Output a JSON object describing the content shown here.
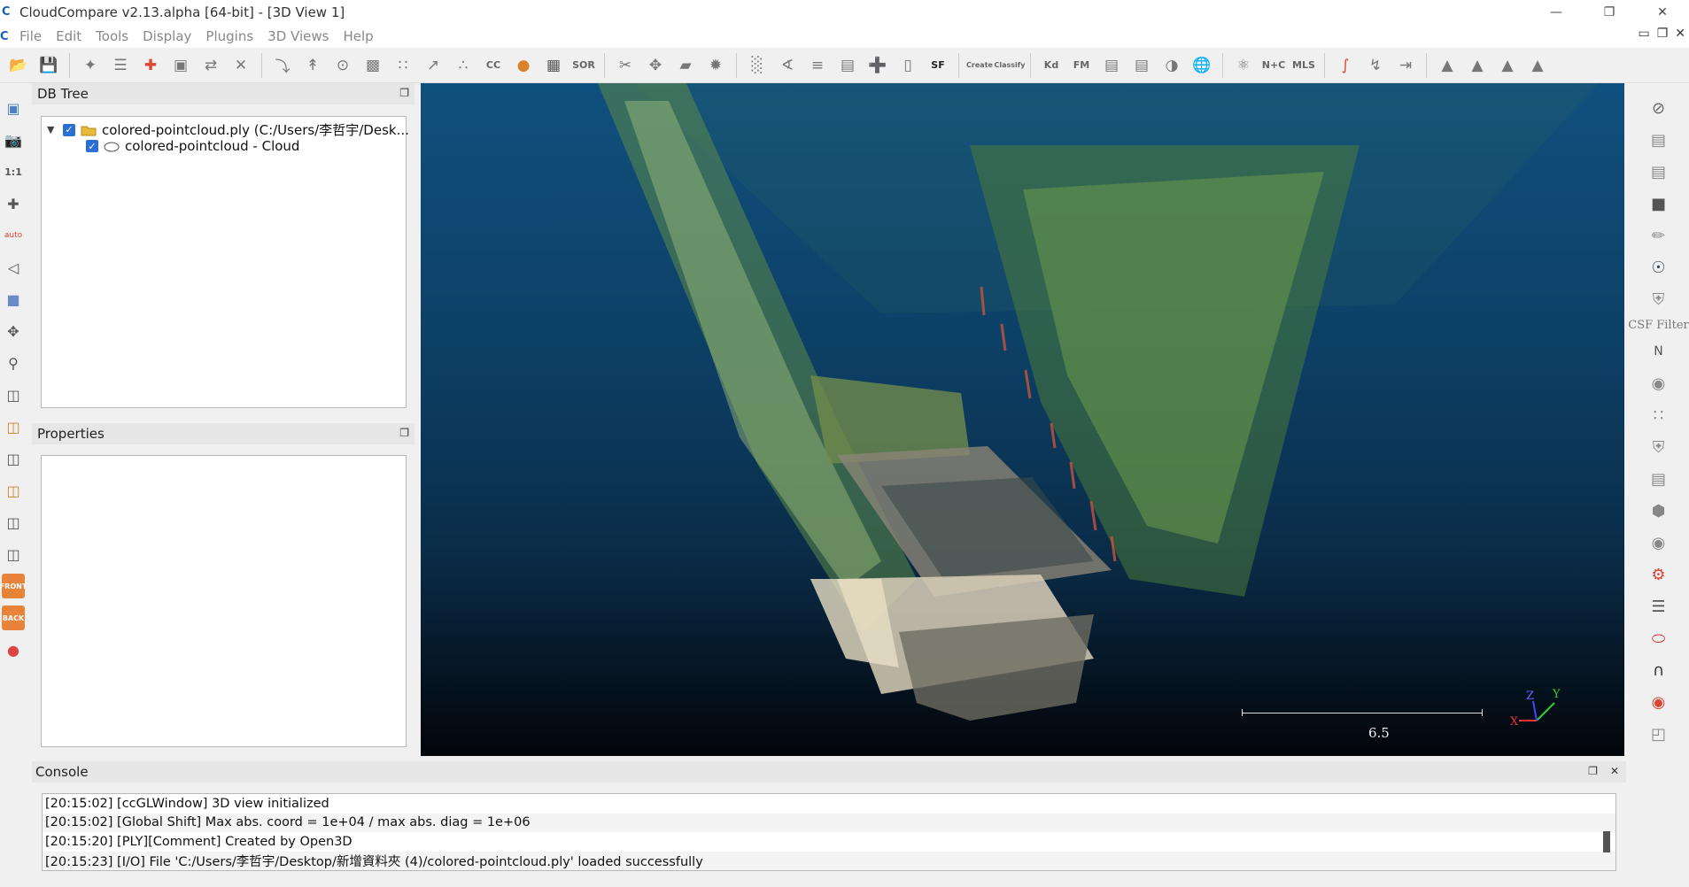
{
  "window": {
    "title": "CloudCompare v2.13.alpha [64-bit] - [3D View 1]"
  },
  "menu": [
    "File",
    "Edit",
    "Tools",
    "Display",
    "Plugins",
    "3D Views",
    "Help"
  ],
  "toolbar": {
    "sor_label": "SOR",
    "sf_label": "SF",
    "canupo_create": "Create",
    "canupo_classify": "Classify",
    "kd_label": "Kd",
    "fm_label": "FM",
    "nc_label": "N+C",
    "mls_label": "MLS",
    "cc_label": "CC"
  },
  "left_toolbar": {
    "scale_label": "1:1",
    "auto_label": "auto",
    "front_label": "FRONT",
    "back_label": "BACK"
  },
  "right_toolbar": {
    "csf_label": "CSF Filter",
    "n_label": "N"
  },
  "db_tree": {
    "title": "DB Tree",
    "items": [
      {
        "label": "colored-pointcloud.ply (C:/Users/李哲宇/Desk...",
        "checked": true,
        "icon": "folder-icon"
      },
      {
        "label": "colored-pointcloud - Cloud",
        "checked": true,
        "icon": "cloud-icon"
      }
    ]
  },
  "properties": {
    "title": "Properties"
  },
  "view3d": {
    "scale_value": "6.5",
    "axis_x": "X",
    "axis_y": "Y",
    "axis_z": "Z"
  },
  "console": {
    "title": "Console",
    "lines": [
      "[20:15:02] [ccGLWindow] 3D view initialized",
      "[20:15:02] [Global Shift] Max abs. coord = 1e+04 / max abs. diag = 1e+06",
      "[20:15:20] [PLY][Comment] Created by Open3D",
      "[20:15:23] [I/O] File 'C:/Users/李哲宇/Desktop/新增資料夾 (4)/colored-pointcloud.ply' loaded successfully"
    ]
  },
  "colors": {
    "accent": "#2a6fd6",
    "view_top": "#10507e",
    "view_bottom": "#020509"
  }
}
